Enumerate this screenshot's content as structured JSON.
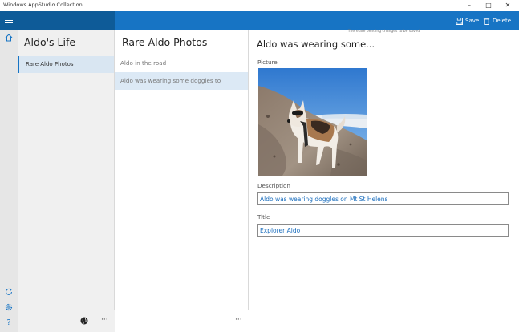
{
  "window": {
    "title": "Windows AppStudio Collection",
    "minimize": "–",
    "maximize": "□",
    "close": "✕"
  },
  "toolbar": {
    "save_label": "Save",
    "delete_label": "Delete"
  },
  "collections": {
    "title": "Aldo's Life",
    "items": [
      {
        "label": "Rare Aldo Photos"
      }
    ],
    "more": "···"
  },
  "list": {
    "title": "Rare Aldo Photos",
    "items": [
      {
        "label": "Aldo in the road"
      },
      {
        "label": "Aldo was wearing some doggles to"
      }
    ],
    "more": "···"
  },
  "detail": {
    "notice": "There are pending changes to be saved",
    "title": "Aldo was wearing some...",
    "picture_label": "Picture",
    "description_label": "Description",
    "description_value": "Aldo was wearing doggles on Mt St Helens",
    "title_label": "Title",
    "title_value": "Explorer Aldo"
  },
  "colors": {
    "accent": "#1774c4",
    "header_dark": "#0e5b98",
    "selected_row": "#dce9f5"
  }
}
